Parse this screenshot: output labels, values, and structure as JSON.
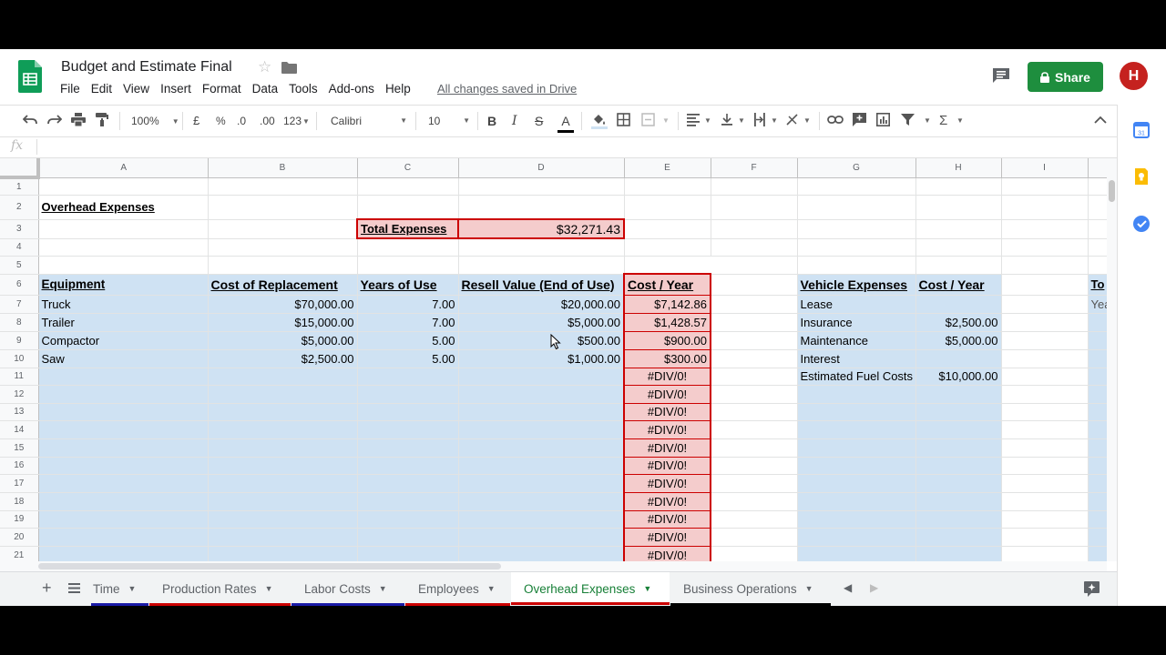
{
  "app": {
    "title": "Budget and Estimate Final",
    "menu": [
      "File",
      "Edit",
      "View",
      "Insert",
      "Format",
      "Data",
      "Tools",
      "Add-ons",
      "Help"
    ],
    "save_status": "All changes saved in Drive",
    "share_label": "Share",
    "avatar_initial": "H",
    "accent_color": "#1e8e3e"
  },
  "toolbar": {
    "zoom": "100%",
    "currency": "£",
    "percent": "%",
    "dec_decrease": ".0",
    "dec_increase": ".00",
    "more_formats": "123",
    "font": "Calibri",
    "font_size": "10",
    "bold": "B",
    "italic": "I",
    "strike": "S",
    "text_color": "A"
  },
  "formula_bar": {
    "fx": "fx",
    "value": ""
  },
  "grid": {
    "columns": [
      "",
      "A",
      "B",
      "C",
      "D",
      "E",
      "F",
      "G",
      "H",
      "I",
      ""
    ],
    "title": "Overhead Expenses",
    "total_label": "Total Expenses",
    "total_value": "$32,271.43",
    "headers": {
      "a": "Equipment",
      "b": "Cost of Replacement",
      "c": "Years of Use",
      "d": "Resell Value (End of Use)",
      "e": "Cost / Year",
      "g": "Vehicle Expenses",
      "h": "Cost / Year",
      "j": "To"
    },
    "equipment": [
      {
        "a": "Truck",
        "b": "$70,000.00",
        "c": "7.00",
        "d": "$20,000.00",
        "e": "$7,142.86"
      },
      {
        "a": "Trailer",
        "b": "$15,000.00",
        "c": "7.00",
        "d": "$5,000.00",
        "e": "$1,428.57"
      },
      {
        "a": "Compactor",
        "b": "$5,000.00",
        "c": "5.00",
        "d": "$500.00",
        "e": "$900.00"
      },
      {
        "a": "Saw",
        "b": "$2,500.00",
        "c": "5.00",
        "d": "$1,000.00",
        "e": "$300.00"
      }
    ],
    "div_error": "#DIV/0!",
    "vehicle": [
      {
        "g": "Lease",
        "h": ""
      },
      {
        "g": "Insurance",
        "h": "$2,500.00"
      },
      {
        "g": "Maintenance",
        "h": "$5,000.00"
      },
      {
        "g": "Interest",
        "h": ""
      },
      {
        "g": "Estimated Fuel Costs",
        "h": "$10,000.00"
      }
    ],
    "j7": "Yea"
  },
  "sheets": [
    {
      "name": "Time",
      "bar": "#1a1aa6"
    },
    {
      "name": "Production Rates",
      "bar": "#cc0000"
    },
    {
      "name": "Labor Costs",
      "bar": "#1a1aa6"
    },
    {
      "name": "Employees",
      "bar": "#cc0000"
    },
    {
      "name": "Overhead Expenses",
      "bar": "#cc0000",
      "active": true
    },
    {
      "name": "Business Operations",
      "bar": "#000000"
    }
  ]
}
